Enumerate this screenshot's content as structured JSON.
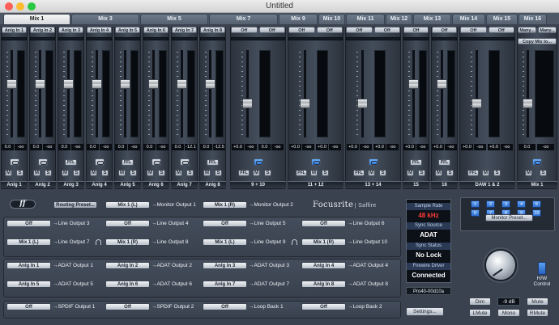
{
  "window": {
    "title": "Untitled",
    "traffic": [
      "#fc5f57",
      "#fdbc2e",
      "#28c840"
    ]
  },
  "tabs": [
    "Mix 1",
    "Mix 3",
    "Mix 5",
    "Mix 7",
    "Mix 9",
    "Mix 10",
    "Mix 11",
    "Mix 12",
    "Mix 13",
    "Mix 14",
    "Mix 15",
    "Mix 16"
  ],
  "active_tab": 0,
  "strips": [
    {
      "name": "Anlg 1",
      "source": "Anlg In 1",
      "value": "0.0",
      "db": "-oo",
      "fader": 0.62,
      "pfl_type": "link",
      "pfl": "PFL",
      "m": "M",
      "s": "S",
      "link_on": false
    },
    {
      "name": "Anlg 2",
      "source": "Anlg In 2",
      "value": "0.0",
      "db": "-oo",
      "fader": 0.62,
      "pfl_type": "link",
      "pfl": "PFL",
      "m": "M",
      "s": "S",
      "link_on": false
    },
    {
      "name": "Anlg 3",
      "source": "Anlg In 3",
      "value": "0.0",
      "db": "-oo",
      "fader": 0.62,
      "pfl_type": "pfl",
      "pfl": "PFL",
      "m": "M",
      "s": "S",
      "link_on": false
    },
    {
      "name": "Anlg 4",
      "source": "Anlg In 4",
      "value": "0.0",
      "db": "-oo",
      "fader": 0.62,
      "pfl_type": "link",
      "pfl": "PFL",
      "m": "M",
      "s": "S",
      "link_on": false
    },
    {
      "name": "Anlg 5",
      "source": "Anlg In 5",
      "value": "0.0",
      "db": "-oo",
      "fader": 0.62,
      "pfl_type": "pfl",
      "pfl": "PFL",
      "m": "M",
      "s": "S",
      "link_on": false
    },
    {
      "name": "Anlg 6",
      "source": "Anlg In 6",
      "value": "0.0",
      "db": "-oo",
      "fader": 0.62,
      "pfl_type": "link",
      "pfl": "PFL",
      "m": "M",
      "s": "S",
      "link_on": false
    },
    {
      "name": "Anlg 7",
      "source": "Anlg In 7",
      "value": "0.0",
      "db": "-12.1",
      "fader": 0.62,
      "pfl_type": "link",
      "pfl": "PFL",
      "m": "M",
      "s": "S",
      "link_on": false
    },
    {
      "name": "Anlg 8",
      "source": "Anlg In 8",
      "value": "0.0",
      "db": "-12.5",
      "fader": 0.62,
      "pfl_type": "pfl",
      "pfl": "PFL",
      "m": "M",
      "s": "S",
      "link_on": false
    }
  ],
  "stereo_strips": [
    {
      "name": "9 + 10",
      "source_l": "Off",
      "source_r": "Off",
      "value_l": "+0.0",
      "db_l": "-oo",
      "value_r": "0.0",
      "db_r": "-oo",
      "link_on": true,
      "m": "M",
      "s": "S",
      "pfl": "PFL"
    },
    {
      "name": "11 + 12",
      "source_l": "Off",
      "source_r": "Off",
      "value_l": "+0.0",
      "db_l": "-oo",
      "value_r": "+0.0",
      "db_r": "-oo",
      "link_on": true,
      "m": "M",
      "s": "S",
      "pfl": "PFL"
    },
    {
      "name": "13 + 14",
      "source_l": "Off",
      "source_r": "Off",
      "value_l": "+0.0",
      "db_l": "-oo",
      "value_r": "+0.0",
      "db_r": "-oo",
      "link_on": true,
      "m": "M",
      "s": "S",
      "pfl": "PFL"
    },
    {
      "name": "15",
      "source": "Off",
      "value": "+0.0",
      "db": "-oo",
      "m": "M",
      "s": "S",
      "pfl": "PFL"
    },
    {
      "name": "16",
      "source": "Off",
      "value": "+0.0",
      "db": "-oo",
      "m": "M",
      "s": "S",
      "pfl": "PFL"
    },
    {
      "name": "DAW 1 & 2",
      "source_l": "Off",
      "source_r": "Off",
      "value_l": "+0.0",
      "db_l": "-oo",
      "value_r": "+0.0",
      "db_r": "-oo",
      "link_on": false,
      "m": "M",
      "s": "S",
      "pfl": "PFL"
    },
    {
      "name": "Mix 1",
      "source_l": "Many...",
      "source_r": "Many...",
      "copy": "Copy Mix to...",
      "value_l": "0.0",
      "db_l": "-oo",
      "link_on": true,
      "m": "M",
      "s": "S"
    }
  ],
  "routing": {
    "routing_preset": "Routing Preset...",
    "rows": [
      [
        {
          "src": "Mix 1 (L)",
          "dst": "Monitor Output 1"
        },
        {
          "src": "Mix 1 (R)",
          "dst": "Monitor Output 2"
        }
      ],
      [
        {
          "src": "Off",
          "dst": "Line Output 3"
        },
        {
          "src": "Off",
          "dst": "Line Output 4"
        },
        {
          "src": "Off",
          "dst": "Line Output 5"
        },
        {
          "src": "Off",
          "dst": "Line Output 6"
        }
      ],
      [
        {
          "src": "Mix 1 (L)",
          "dst": "Line Output 7",
          "hp": true
        },
        {
          "src": "Mix 1 (R)",
          "dst": "Line Output 8"
        },
        {
          "src": "Mix 1 (L)",
          "dst": "Line Output 9",
          "hp": true
        },
        {
          "src": "Mix 1 (R)",
          "dst": "Line Output 10"
        }
      ],
      [
        {
          "src": "Anlg In 1",
          "dst": "ADAT Output 1"
        },
        {
          "src": "Anlg In 2",
          "dst": "ADAT Output 2"
        },
        {
          "src": "Anlg In 3",
          "dst": "ADAT Output 3"
        },
        {
          "src": "Anlg In 4",
          "dst": "ADAT Output 4"
        }
      ],
      [
        {
          "src": "Anlg In 5",
          "dst": "ADAT Output 5"
        },
        {
          "src": "Anlg In 6",
          "dst": "ADAT Output 6"
        },
        {
          "src": "Anlg In 7",
          "dst": "ADAT Output 7"
        },
        {
          "src": "Anlg In 8",
          "dst": "ADAT Output 8"
        }
      ],
      [
        {
          "src": "Off",
          "dst": "SPDIF Output 1"
        },
        {
          "src": "Off",
          "dst": "SPDIF Output 2"
        },
        {
          "src": "Off",
          "dst": "Loop Back 1"
        },
        {
          "src": "Off",
          "dst": "Loop Back 2"
        }
      ]
    ]
  },
  "brand": {
    "name": "Focusrite",
    "product": "Saffire",
    "logo_glyph": "ff"
  },
  "status": {
    "sample_rate_label": "Sample Rate",
    "sample_rate": "48 kHz",
    "sync_source_label": "Sync Source",
    "sync_source": "ADAT",
    "sync_status_label": "Sync Status",
    "sync_status": "No Lock",
    "firewire_label": "Firewire Driver",
    "firewire": "Connected",
    "device": "Pro40-00d10a",
    "settings": "Settings..."
  },
  "monitor": {
    "presets": [
      "1",
      "2",
      "3",
      "4",
      "5",
      "6",
      "7",
      "8",
      "9",
      "10"
    ],
    "monitor_preset": "Monitor Preset...",
    "hw_control": "H/W\nControl",
    "dim": "Dim",
    "db": "-9 dB",
    "mute": "Mute",
    "lmute": "LMute",
    "mono": "Mono",
    "rmute": "RMute"
  }
}
